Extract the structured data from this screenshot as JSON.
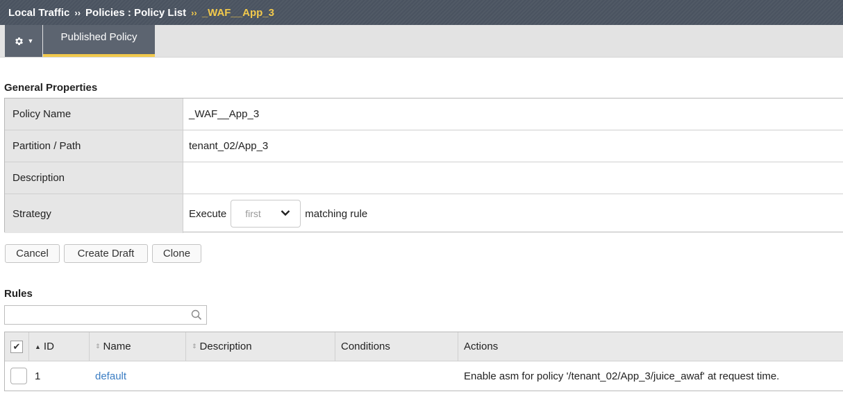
{
  "breadcrumb": {
    "items": [
      "Local Traffic",
      "Policies : Policy List"
    ],
    "separator": "››",
    "current": "_WAF__App_3"
  },
  "tabs": {
    "active": "Published Policy",
    "gear_icon": "gear-icon"
  },
  "general": {
    "title": "General Properties",
    "rows": [
      {
        "label": "Policy Name",
        "value": "_WAF__App_3"
      },
      {
        "label": "Partition / Path",
        "value": "tenant_02/App_3"
      },
      {
        "label": "Description",
        "value": ""
      },
      {
        "label": "Strategy",
        "prefix": "Execute",
        "select": "first",
        "suffix": "matching rule"
      }
    ]
  },
  "buttons": {
    "cancel": "Cancel",
    "create_draft": "Create Draft",
    "clone": "Clone"
  },
  "rules": {
    "title": "Rules",
    "search_placeholder": "",
    "columns": [
      "ID",
      "Name",
      "Description",
      "Conditions",
      "Actions"
    ],
    "rows": [
      {
        "id": "1",
        "name": "default",
        "description": "",
        "conditions": "",
        "actions": "Enable asm for policy '/tenant_02/App_3/juice_awaf' at request time."
      }
    ]
  },
  "colors": {
    "topbar": "#4a5360",
    "accent": "#f2c94c",
    "link": "#3b7dc3"
  }
}
